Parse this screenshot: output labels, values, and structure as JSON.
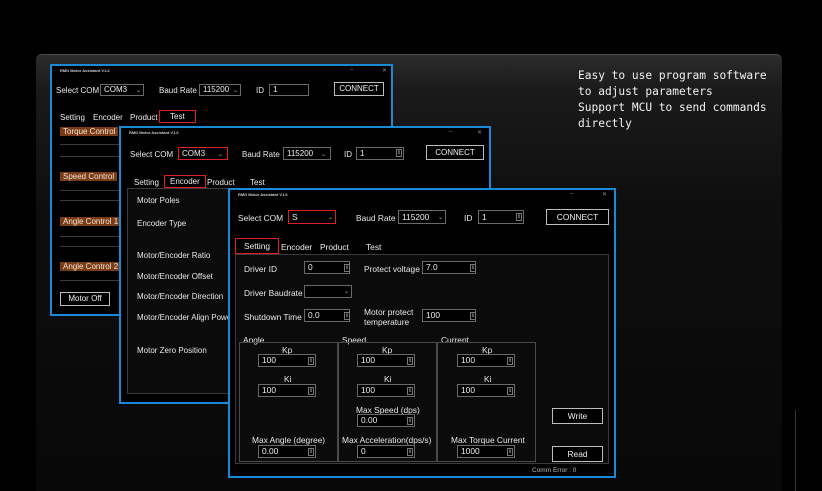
{
  "promo": {
    "line1": "Easy to use program software",
    "line2": "to adjust parameters",
    "line3": "Support MCU to send commands",
    "line4": "directly"
  },
  "app": {
    "title": "RMD Motor Assistant V1.6"
  },
  "conn": {
    "select_com_label": "Select COM",
    "baud_label": "Baud Rate",
    "id_label": "ID",
    "connect_label": "CONNECT"
  },
  "tabs": {
    "setting": "Setting",
    "encoder": "Encoder",
    "product": "Product",
    "test": "Test"
  },
  "win1": {
    "com_value": "COM3",
    "baud_value": "115200",
    "id_value": "1",
    "side": [
      "Torque Control",
      "Speed Control",
      "Angle Control 1",
      "Angle Control 2"
    ],
    "motor_off": "Motor Off"
  },
  "win2": {
    "com_value": "COM3",
    "baud_value": "115200",
    "id_value": "1",
    "encoder_rows": [
      "Motor Poles",
      "Encoder Type",
      "Motor/Encoder Ratio",
      "Motor/Encoder Offset",
      "Motor/Encoder Direction",
      "Motor/Encoder Align Powe",
      "Motor Zero Position"
    ]
  },
  "win3": {
    "com_value": "S",
    "baud_value": "115200",
    "id_value": "1",
    "driver_id_label": "Driver ID",
    "driver_id_value": "0",
    "protect_voltage_label": "Protect voltage",
    "protect_voltage_value": "7.0",
    "driver_baudrate_label": "Driver Baudrate",
    "driver_baudrate_value": "",
    "shutdown_label": "Shutdown Time",
    "shutdown_value": "0.0",
    "motor_protect_label1": "Motor protect",
    "motor_protect_label2": "temperature",
    "motor_protect_value": "100",
    "angle": {
      "title": "Angle",
      "kp_label": "Kp",
      "kp": "100",
      "ki_label": "Ki",
      "ki": "100",
      "max_label": "Max Angle (degree)",
      "max": "0.00"
    },
    "speed": {
      "title": "Speed",
      "kp_label": "Kp",
      "kp": "100",
      "ki_label": "Ki",
      "ki": "100",
      "maxspd_label": "Max Speed (dps)",
      "maxspd": "0.00",
      "maxacc_label": "Max Acceleration(dps/s)",
      "maxacc": "0"
    },
    "current": {
      "title": "Current",
      "kp_label": "Kp",
      "kp": "100",
      "ki_label": "Ki",
      "ki": "100",
      "max_label": "Max Torque Current",
      "max": "1000"
    },
    "write_label": "Write",
    "read_label": "Read",
    "comm_error": "Comm Error : 0"
  }
}
